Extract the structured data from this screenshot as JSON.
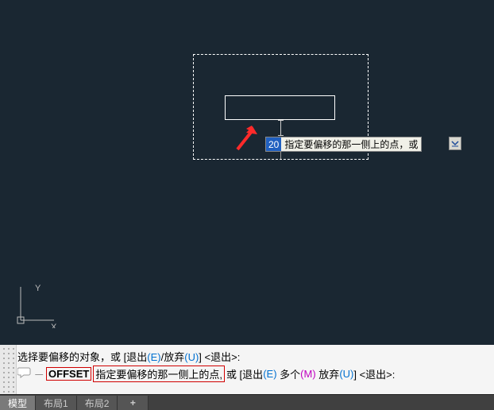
{
  "dynamic_input": {
    "value": "20",
    "prompt": "指定要偏移的那一侧上的点，或"
  },
  "ucs": {
    "x_label": "X",
    "y_label": "Y"
  },
  "command_history": {
    "line1_pre": "选择要偏移的对象，或 [",
    "line1_exit": "退出",
    "line1_exit_key": "(E)",
    "line1_sep": "/",
    "line1_discard": "放弃",
    "line1_discard_key": "(U)",
    "line1_post": "] <退出>:"
  },
  "command_current": {
    "dash_icon": "⏤",
    "command": "OFFSET",
    "highlighted_prompt": "指定要偏移的那一侧上的点,",
    "or": "或 [",
    "exit": "退出",
    "exit_key": "(E)",
    "multi": "多个",
    "multi_key": "(M)",
    "discard": "放弃",
    "discard_key": "(U)",
    "post": "] <退出>:"
  },
  "tabs": {
    "model": "模型",
    "layout1": "布局1",
    "layout2": "布局2",
    "plus": "+"
  }
}
